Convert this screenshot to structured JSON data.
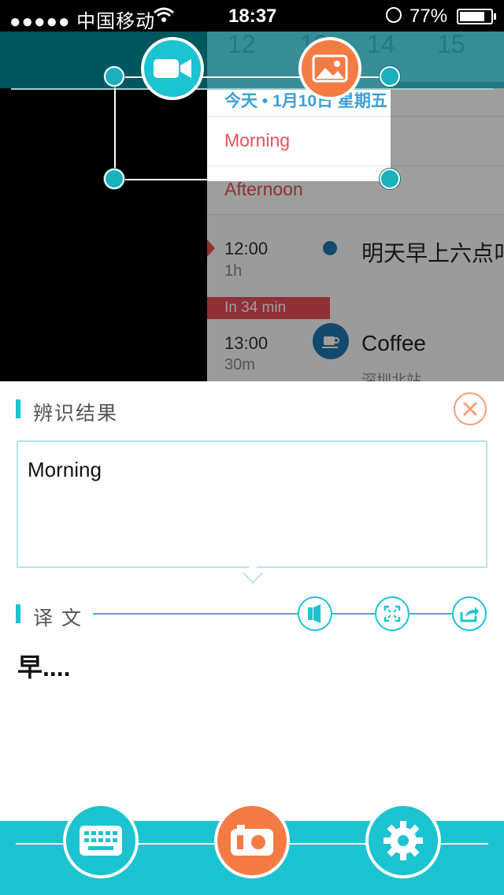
{
  "status_bar": {
    "carrier": "●●●●● 中国移动",
    "time": "18:37",
    "battery": "77%"
  },
  "preview": {
    "dates": [
      "12",
      "13",
      "14",
      "15"
    ],
    "calendar_header": "今天 • 1月10日 星期五",
    "morning": "Morning",
    "afternoon": "Afternoon",
    "event1_time": "12:00",
    "event1_duration": "1h",
    "event1_title": "明天早上六点叫",
    "countdown": "In 34 min",
    "event2_time": "13:00",
    "event2_duration": "30m",
    "event2_title": "Coffee",
    "event2_location": "深圳北站"
  },
  "result": {
    "title": "辨识结果",
    "text": "Morning"
  },
  "translation": {
    "title": "译 文",
    "text": "早...."
  },
  "colors": {
    "accent": "#1cc3d0",
    "orange": "#f47b44",
    "close": "#f4a07a"
  },
  "icons": {
    "video": "video-camera-icon",
    "image": "image-icon",
    "close": "close-icon",
    "speaker": "speaker-icon",
    "fullscreen": "fullscreen-icon",
    "share": "share-icon",
    "keyboard": "keyboard-icon",
    "camera": "camera-icon",
    "settings": "gear-icon"
  }
}
